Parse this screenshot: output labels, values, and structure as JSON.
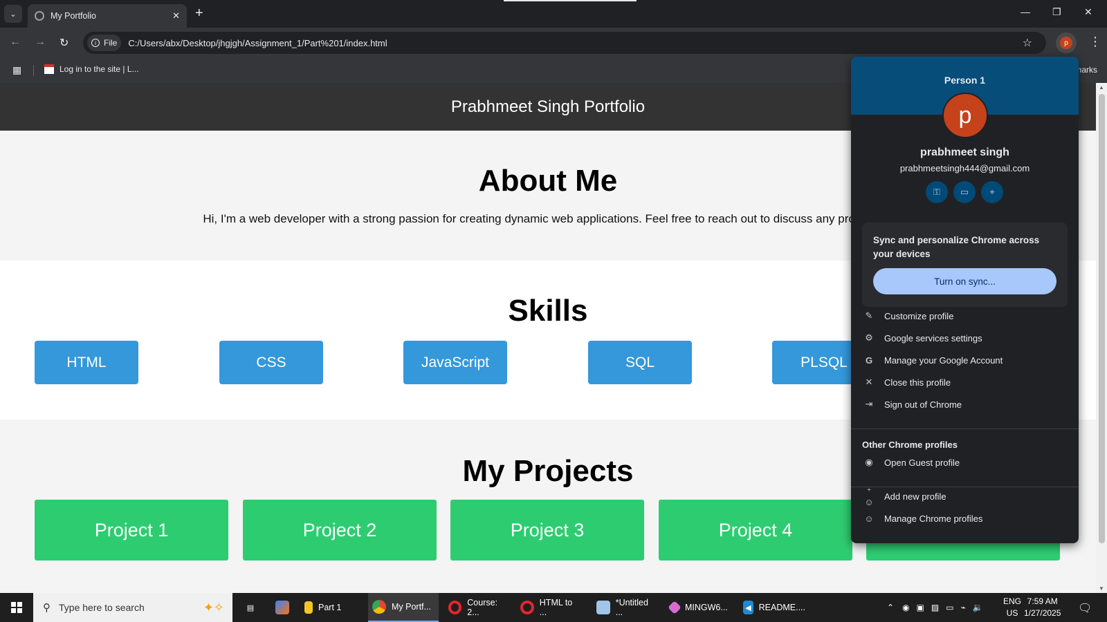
{
  "browser": {
    "tab_title": "My Portfolio",
    "url_chip": "File",
    "url": "C:/Users/abx/Desktop/jhgjgh/Assignment_1/Part%201/index.html",
    "bookmark_item": "Log in to the site | L...",
    "bookmarks_right": "narks"
  },
  "page": {
    "header_title": "Prabhmeet Singh Portfolio",
    "about_title": "About Me",
    "about_text": "Hi, I'm a web developer with a strong passion for creating dynamic web applications. Feel free to reach out to discuss any projects or",
    "skills_title": "Skills",
    "skills": [
      "HTML",
      "CSS",
      "JavaScript",
      "SQL",
      "PLSQL"
    ],
    "projects_title": "My Projects",
    "projects": [
      "Project 1",
      "Project 2",
      "Project 3",
      "Project 4"
    ]
  },
  "profile_popup": {
    "header": "Person 1",
    "avatar_letter": "p",
    "name": "prabhmeet singh",
    "email": "prabhmeetsingh444@gmail.com",
    "sync_text": "Sync and personalize Chrome across your devices",
    "sync_button": "Turn on sync...",
    "menu": [
      {
        "icon": "pencil-icon",
        "label": "Customize profile"
      },
      {
        "icon": "gear-icon",
        "label": "Google services settings"
      },
      {
        "icon": "google-icon",
        "label": "Manage your Google Account"
      },
      {
        "icon": "close-icon",
        "label": "Close this profile"
      },
      {
        "icon": "sign-out-icon",
        "label": "Sign out of Chrome"
      }
    ],
    "other_profiles_title": "Other Chrome profiles",
    "guest_label": "Open Guest profile",
    "add_profile": "Add new profile",
    "manage_profiles": "Manage Chrome profiles"
  },
  "taskbar": {
    "search_placeholder": "Type here to search",
    "apps": [
      "Part 1",
      "My Portf...",
      "Course: 2...",
      "HTML to ...",
      "*Untitled ...",
      "MINGW6...",
      "README...."
    ],
    "lang_1": "ENG",
    "lang_2": "US",
    "time": "7:59 AM",
    "date": "1/27/2025"
  },
  "colors": {
    "skill_blue": "#3498db",
    "project_green": "#2ecc71",
    "profile_orange": "#c5421a",
    "popup_header": "#074d7a",
    "sync_button": "#a8c7fa"
  }
}
